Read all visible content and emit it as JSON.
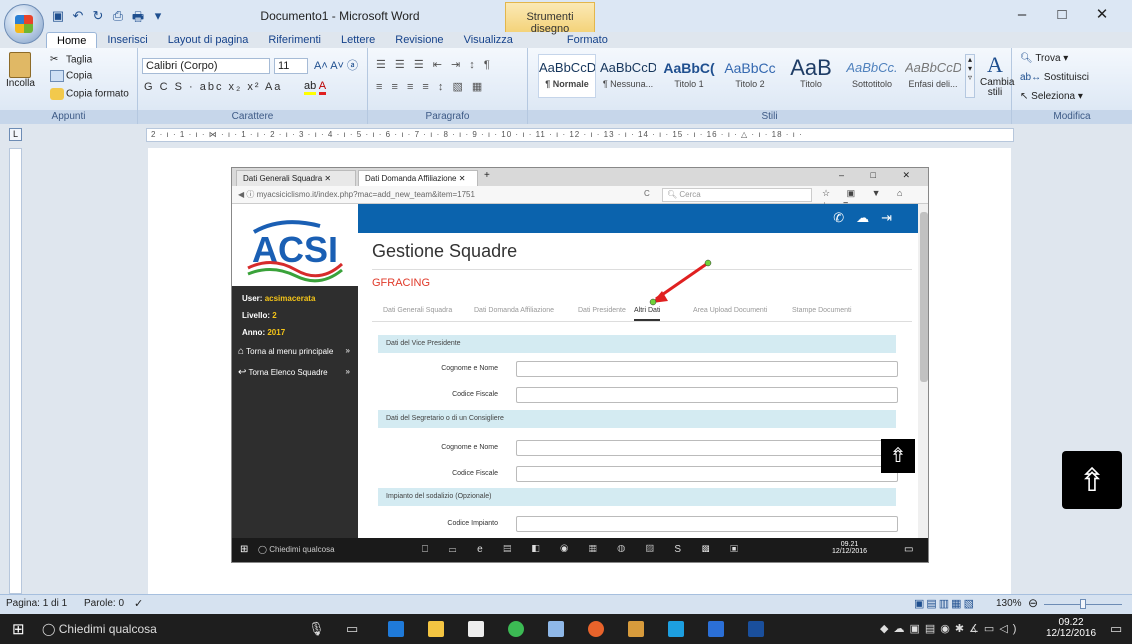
{
  "window": {
    "title": "Documento1 - Microsoft Word",
    "context_tab": "Strumenti disegno",
    "controls": [
      "–",
      "□",
      "✕"
    ]
  },
  "ribbon_tabs": [
    "Home",
    "Inserisci",
    "Layout di pagina",
    "Riferimenti",
    "Lettere",
    "Revisione",
    "Visualizza",
    "Formato"
  ],
  "ribbon": {
    "clipboard": {
      "paste": "Incolla",
      "cut": "Taglia",
      "copy": "Copia",
      "format_painter": "Copia formato",
      "label": "Appunti"
    },
    "font": {
      "family": "Calibri (Corpo)",
      "size": "11",
      "label": "Carattere"
    },
    "paragraph": {
      "label": "Paragrafo"
    },
    "styles": {
      "label": "Stili",
      "items": [
        {
          "preview": "AaBbCcDc",
          "name": "¶ Normale"
        },
        {
          "preview": "AaBbCcDc",
          "name": "¶ Nessuna..."
        },
        {
          "preview": "AaBbC(",
          "name": "Titolo 1"
        },
        {
          "preview": "AaBbCc",
          "name": "Titolo 2"
        },
        {
          "preview": "AaB",
          "name": "Titolo"
        },
        {
          "preview": "AaBbCc.",
          "name": "Sottotitolo"
        },
        {
          "preview": "AaBbCcD(",
          "name": "Enfasi deli..."
        }
      ],
      "change_styles": "Cambia stili"
    },
    "editing": {
      "find": "Trova",
      "replace": "Sostituisci",
      "select": "Seleziona",
      "label": "Modifica"
    }
  },
  "ruler": {
    "marks": "2 · ı · 1 · ı · ⋈ · ı · 1 · ı · 2 · ı · 3 · ı · 4 · ı · 5 · ı · 6 · ı · 7 · ı · 8 · ı · 9 · ı · 10 · ı · 11 · ı · 12 · ı · 13 · ı · 14 · ı · 15 · ı · 16 · ı · △ · ı · 18 · ı ·"
  },
  "browser": {
    "tabs": [
      "Dati Generali Squadra",
      "Dati Domanda Affiliazione",
      "Dati Presidente",
      "Altri Dati",
      "Area Upload Documenti",
      "Stampe Documenti"
    ],
    "url": "myacsiciclismo.it/index.php?mac=add_new_team&item=1751",
    "search_placeholder": "Cerca",
    "site_logo": "ACSI",
    "sidebar": {
      "user_label": "User:",
      "user": "acsimacerata",
      "level_label": "Livello:",
      "level": "2",
      "year_label": "Anno:",
      "year": "2017",
      "nav": [
        "Torna al menu principale",
        "Torna Elenco Squadre"
      ]
    },
    "page_title": "Gestione Squadre",
    "team_name": "GFRACING",
    "sections": [
      {
        "title": "Dati del Vice Presidente",
        "fields": [
          "Cognome e Nome",
          "Codice Fiscale"
        ]
      },
      {
        "title": "Dati del Segretario o di un Consigliere",
        "fields": [
          "Cognome e Nome",
          "Codice Fiscale"
        ]
      },
      {
        "title": "Impianto del sodalizio (Opzionale)",
        "fields": [
          "Codice Impianto"
        ]
      }
    ],
    "inner_taskbar": {
      "search": "Chiedimi qualcosa",
      "time": "09.21",
      "date": "12/12/2016"
    }
  },
  "statusbar": {
    "page": "Pagina: 1 di 1",
    "words": "Parole: 0",
    "zoom": "130%"
  },
  "taskbar": {
    "search": "Chiedimi qualcosa",
    "time": "09.22",
    "date": "12/12/2016"
  }
}
